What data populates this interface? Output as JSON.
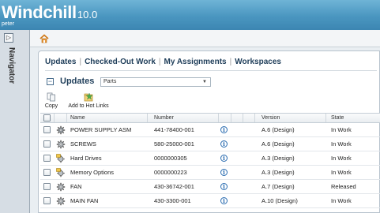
{
  "app": {
    "brand_w": "W",
    "brand_rest": "indchill",
    "version": "10.0",
    "user": "peter"
  },
  "navigator": {
    "toggle": "▷",
    "label": "Navigator"
  },
  "tabs": [
    {
      "label": "Updates"
    },
    {
      "label": "Checked-Out Work"
    },
    {
      "label": "My Assignments"
    },
    {
      "label": "Workspaces"
    }
  ],
  "updates": {
    "collapse": "⊟",
    "title": "Updates",
    "filter_value": "Parts",
    "filter_arrow": "▼"
  },
  "toolbar": {
    "copy_label": "Copy",
    "hot_links_label": "Add to Hot Links"
  },
  "table": {
    "columns": {
      "name": "Name",
      "number": "Number",
      "version": "Version",
      "state": "State"
    },
    "rows": [
      {
        "icon": "assembly-gear-icon",
        "name": "POWER SUPPLY ASM",
        "number": "441-78400-001",
        "info": "i",
        "version": "A.6 (Design)",
        "state": "In Work"
      },
      {
        "icon": "part-gear-icon",
        "name": "SCREWS",
        "number": "580-25000-001",
        "info": "i",
        "version": "A.6 (Design)",
        "state": "In Work"
      },
      {
        "icon": "configurable-part-icon",
        "name": "Hard Drives",
        "number": "0000000305",
        "info": "i",
        "version": "A.3 (Design)",
        "state": "In Work"
      },
      {
        "icon": "configurable-part-icon",
        "name": "Memory Options",
        "number": "0000000223",
        "info": "i",
        "version": "A.3 (Design)",
        "state": "In Work"
      },
      {
        "icon": "part-gear-icon",
        "name": "FAN",
        "number": "430-36742-001",
        "info": "i",
        "version": "A.7 (Design)",
        "state": "Released"
      },
      {
        "icon": "part-gear-icon",
        "name": "MAIN FAN",
        "number": "430-3300-001",
        "info": "i",
        "version": "A.10 (Design)",
        "state": "In Work"
      }
    ]
  },
  "colors": {
    "header": "#4a96c0",
    "nav_strip": "#d6dde4",
    "tab_text": "#1f3e5a",
    "info_icon": "#2a6cb0"
  }
}
